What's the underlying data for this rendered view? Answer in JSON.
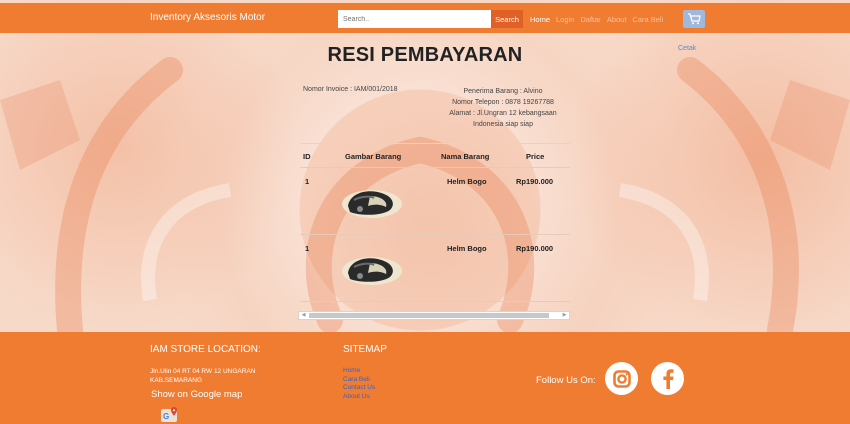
{
  "navbar": {
    "brand": "Inventory Aksesoris Motor",
    "search_placeholder": "Search..",
    "search_button": "Search",
    "links": [
      "Home",
      "Login",
      "Daftar",
      "About",
      "Cara Beli"
    ],
    "cart_icon": "cart-icon"
  },
  "main": {
    "print_link": "Cetak",
    "title": "RESI PEMBAYARAN",
    "invoice_number": "Nomor Invoice : IAM/001/2018",
    "receiver": {
      "name": "Penerima Barang : Alvino",
      "phone": "Nomor Telepon : 0878 19267788",
      "address_1": "Alamat : Jl.Ungran 12 kebangsaan",
      "address_2": "Indonesia siap siap"
    },
    "table": {
      "headers": [
        "ID",
        "Gambar Barang",
        "Nama Barang",
        "Price"
      ],
      "rows": [
        {
          "id": "1",
          "image_icon": "helmet-image",
          "name": "Helm Bogo",
          "price": "Rp190.000"
        },
        {
          "id": "1",
          "image_icon": "helmet-image",
          "name": "Helm Bogo",
          "price": "Rp190.000"
        }
      ]
    }
  },
  "footer": {
    "location_heading": "IAM STORE LOCATION:",
    "address_line_1": "Jln.Ulin 04 RT 04 RW 12 UNGARAN",
    "address_line_2": "KAB.SEMARANG",
    "map_link": "Show on Google map",
    "map_icon": "google-maps-icon",
    "sitemap_heading": "SITEMAP",
    "sitemap_links": [
      "Home",
      "Cara Beli",
      "Contact Us",
      "About Us"
    ],
    "follow_text": "Follow Us On:",
    "social_icons": [
      "instagram-icon",
      "facebook-icon"
    ]
  },
  "colors": {
    "primary_orange": "#f07c31",
    "search_button": "#e06025",
    "link_blue": "#4a90d9",
    "sitemap_link": "#3d61c2"
  }
}
